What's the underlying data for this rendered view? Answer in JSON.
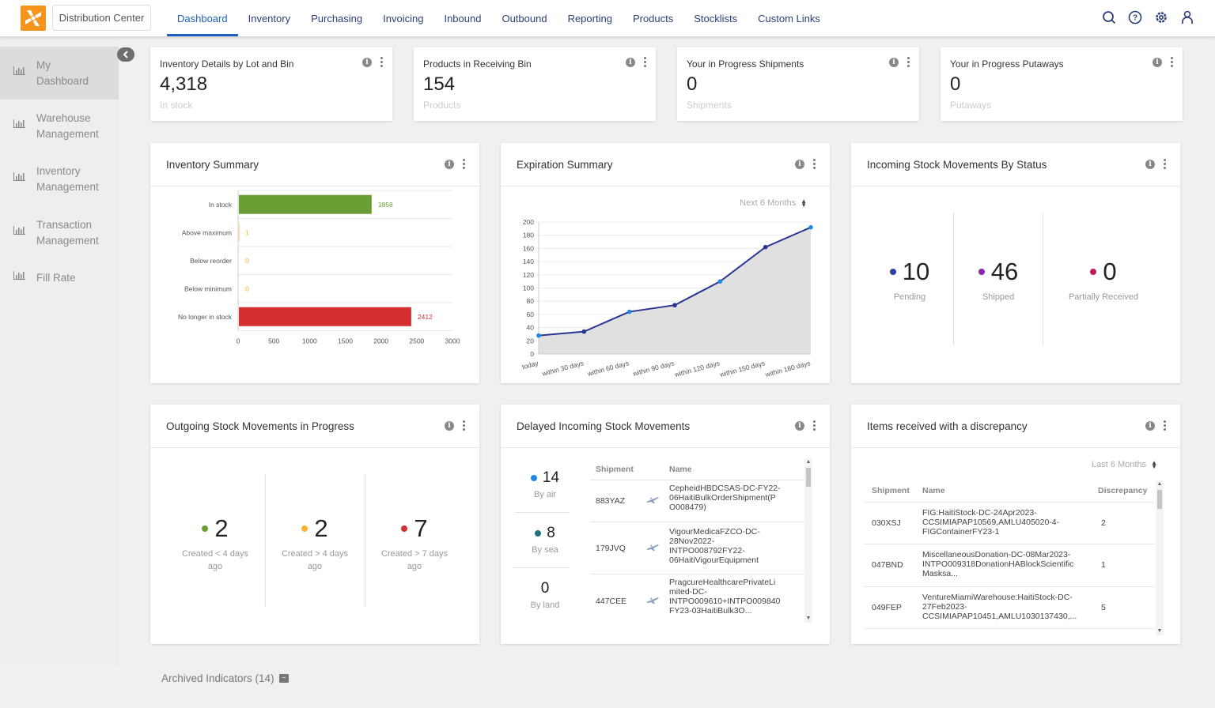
{
  "header": {
    "location": "Distribution Center",
    "nav": [
      "Dashboard",
      "Inventory",
      "Purchasing",
      "Invoicing",
      "Inbound",
      "Outbound",
      "Reporting",
      "Products",
      "Stocklists",
      "Custom Links"
    ],
    "active_nav": "Dashboard",
    "icons": [
      "search-icon",
      "help-icon",
      "settings-icon",
      "user-icon"
    ]
  },
  "sidebar": {
    "items": [
      {
        "label_1": "My",
        "label_2": "Dashboard",
        "active": true
      },
      {
        "label_1": "Warehouse",
        "label_2": "Management",
        "active": false
      },
      {
        "label_1": "Inventory",
        "label_2": "Management",
        "active": false
      },
      {
        "label_1": "Transaction",
        "label_2": "Management",
        "active": false
      },
      {
        "label_1": "Fill Rate",
        "label_2": "",
        "active": false
      }
    ]
  },
  "small_cards": [
    {
      "title": "Inventory Details by Lot and Bin",
      "value": "4,318",
      "sub": "In stock"
    },
    {
      "title": "Products in Receiving Bin",
      "value": "154",
      "sub": "Products"
    },
    {
      "title": "Your in Progress Shipments",
      "value": "0",
      "sub": "Shipments"
    },
    {
      "title": "Your in Progress Putaways",
      "value": "0",
      "sub": "Putaways"
    }
  ],
  "inventory_summary": {
    "title": "Inventory Summary"
  },
  "expiration_summary": {
    "title": "Expiration Summary",
    "filter": "Next 6 Months"
  },
  "incoming_by_status": {
    "title": "Incoming Stock Movements By Status",
    "metrics": [
      {
        "value": "10",
        "label": "Pending",
        "color": "#2c3e9e"
      },
      {
        "value": "46",
        "label": "Shipped",
        "color": "#8e24aa"
      },
      {
        "value": "0",
        "label": "Partially Received",
        "color": "#c2185b"
      }
    ]
  },
  "outgoing_in_progress": {
    "title": "Outgoing Stock Movements in Progress",
    "metrics": [
      {
        "value": "2",
        "label_1": "Created < 4 days",
        "label_2": "ago",
        "color": "#6a9e35"
      },
      {
        "value": "2",
        "label_1": "Created > 4 days",
        "label_2": "ago",
        "color": "#f9b52b"
      },
      {
        "value": "7",
        "label_1": "Created > 7 days",
        "label_2": "ago",
        "color": "#d32f2f"
      }
    ]
  },
  "delayed_incoming": {
    "title": "Delayed Incoming Stock Movements",
    "metrics": [
      {
        "value": "14",
        "label": "By air",
        "color": "#1e88e5"
      },
      {
        "value": "8",
        "label": "By sea",
        "color": "#1f6e80"
      },
      {
        "value": "0",
        "label": "By land",
        "color": ""
      }
    ],
    "columns": [
      "Shipment",
      "Name"
    ],
    "rows": [
      {
        "shipment": "883YAZ",
        "icon": "airplane-icon",
        "name_lines": [
          "CepheidHBDCSAS-DC-FY22-",
          "06HaitiBulkOrderShipment(P",
          "O008479)"
        ]
      },
      {
        "shipment": "179JVQ",
        "icon": "airplane-icon",
        "name_lines": [
          "VigourMedicaFZCO-DC-",
          "28Nov2022-",
          "INTPO008792FY22-",
          "06HaitiVigourEquipment"
        ]
      },
      {
        "shipment": "447CEE",
        "icon": "airplane-icon",
        "name_lines": [
          "PragcureHealthcarePrivateLi",
          "mited-DC-",
          "INTPO009610+INTPO009840",
          "FY23-03HaitiBulk3O..."
        ]
      }
    ]
  },
  "discrepancy": {
    "title": "Items received with a discrepancy",
    "filter": "Last 6 Months",
    "columns": [
      "Shipment",
      "Name",
      "Discrepancy"
    ],
    "rows": [
      {
        "shipment": "030XSJ",
        "name_lines": [
          "FIG:HaitiStock-DC-24Apr2023-",
          "CCSIMIAPAP10569,AMLU405020-4-",
          "FIGContainerFY23-1"
        ],
        "discrepancy": "2"
      },
      {
        "shipment": "047BND",
        "name_lines": [
          "MiscellaneousDonation-DC-08Mar2023-",
          "INTPO009318DonationHABlockScientific",
          "Masksa..."
        ],
        "discrepancy": "1"
      },
      {
        "shipment": "049FEP",
        "name_lines": [
          "VentureMiamiWarehouse:HaitiStock-DC-",
          "27Feb2023-",
          "CCSIMIAPAP10451,AMLU1030137430,..."
        ],
        "discrepancy": "5"
      }
    ]
  },
  "archived": {
    "label": "Archived Indicators (14)"
  },
  "chart_data": [
    {
      "type": "bar",
      "orientation": "horizontal",
      "title": "Inventory Summary",
      "categories": [
        "In stock",
        "Above maximum",
        "Below reorder",
        "Below minimum",
        "No longer in stock"
      ],
      "values": [
        1858,
        1,
        0,
        0,
        2412
      ],
      "colors": [
        "#6a9e35",
        "#f9b52b",
        "#f9b52b",
        "#f9b52b",
        "#d32f2f"
      ],
      "xlim": [
        0,
        3000
      ],
      "xticks": [
        0,
        500,
        1000,
        1500,
        2000,
        2500,
        3000
      ],
      "grid": true,
      "data_labels": true
    },
    {
      "type": "area",
      "title": "Expiration Summary",
      "categories": [
        "today",
        "within 30 days",
        "within 60 days",
        "within 90 days",
        "within 120 days",
        "within 150 days",
        "within 180 days"
      ],
      "values": [
        28,
        34,
        64,
        74,
        110,
        162,
        192
      ],
      "ylim": [
        0,
        200
      ],
      "yticks": [
        0,
        20,
        40,
        60,
        80,
        100,
        120,
        140,
        160,
        180,
        200
      ],
      "line_color": "#283593",
      "fill_color": "#e0e0e0",
      "grid": true
    }
  ]
}
